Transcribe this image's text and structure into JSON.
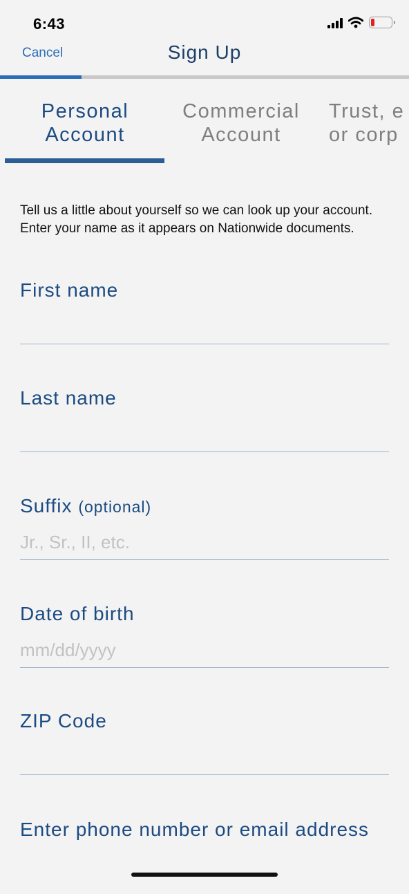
{
  "status_bar": {
    "time": "6:43",
    "icons": [
      "cellular-signal-icon",
      "wifi-icon",
      "battery-low-icon"
    ],
    "battery_color": "#e02020"
  },
  "nav": {
    "cancel_label": "Cancel",
    "title": "Sign Up"
  },
  "progress": {
    "fraction": 0.2,
    "color": "#2a6cb6"
  },
  "tabs": [
    {
      "line1": "Personal",
      "line2": "Account",
      "selected": true
    },
    {
      "line1": "Commercial",
      "line2": "Account",
      "selected": false
    },
    {
      "line1": "Trust, e",
      "line2": "or corp",
      "selected": false
    }
  ],
  "intro_text": "Tell us a little about yourself so we can look up your account. Enter your name as it appears on Nationwide documents.",
  "fields": {
    "first_name": {
      "label": "First name",
      "value": "",
      "placeholder": ""
    },
    "last_name": {
      "label": "Last name",
      "value": "",
      "placeholder": ""
    },
    "suffix": {
      "label": "Suffix",
      "optional": "(optional)",
      "value": "",
      "placeholder": "Jr., Sr., II, etc."
    },
    "dob": {
      "label": "Date of birth",
      "value": "",
      "placeholder": "mm/dd/yyyy"
    },
    "zip": {
      "label": "ZIP Code",
      "value": "",
      "placeholder": ""
    },
    "contact": {
      "label": "Enter phone number or email address",
      "value": "",
      "placeholder": ""
    }
  },
  "colors": {
    "accent": "#2a6cb6",
    "label": "#1c4b82",
    "background": "#f3f3f3"
  }
}
